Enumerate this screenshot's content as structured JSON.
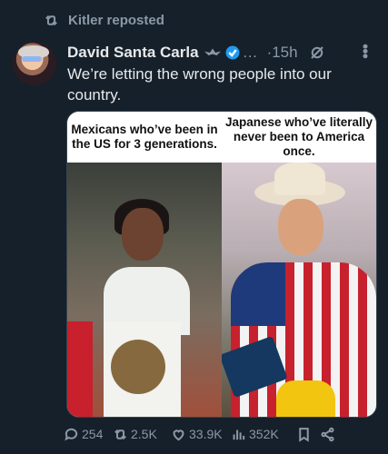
{
  "repost": {
    "icon": "repost-icon",
    "text": "Kitler reposted"
  },
  "tweet": {
    "author_name": "David Santa Carla",
    "handle": "…",
    "time": "·15h",
    "text": "We’re letting the wrong people into our country.",
    "verified_color": "#1d9bf0"
  },
  "media": {
    "left_caption": "Mexicans who’ve been in the US for 3 generations.",
    "right_caption": "Japanese who’ve literally never been to America once."
  },
  "actions": {
    "replies": "254",
    "reposts": "2.5K",
    "likes": "33.9K",
    "views": "352K"
  }
}
